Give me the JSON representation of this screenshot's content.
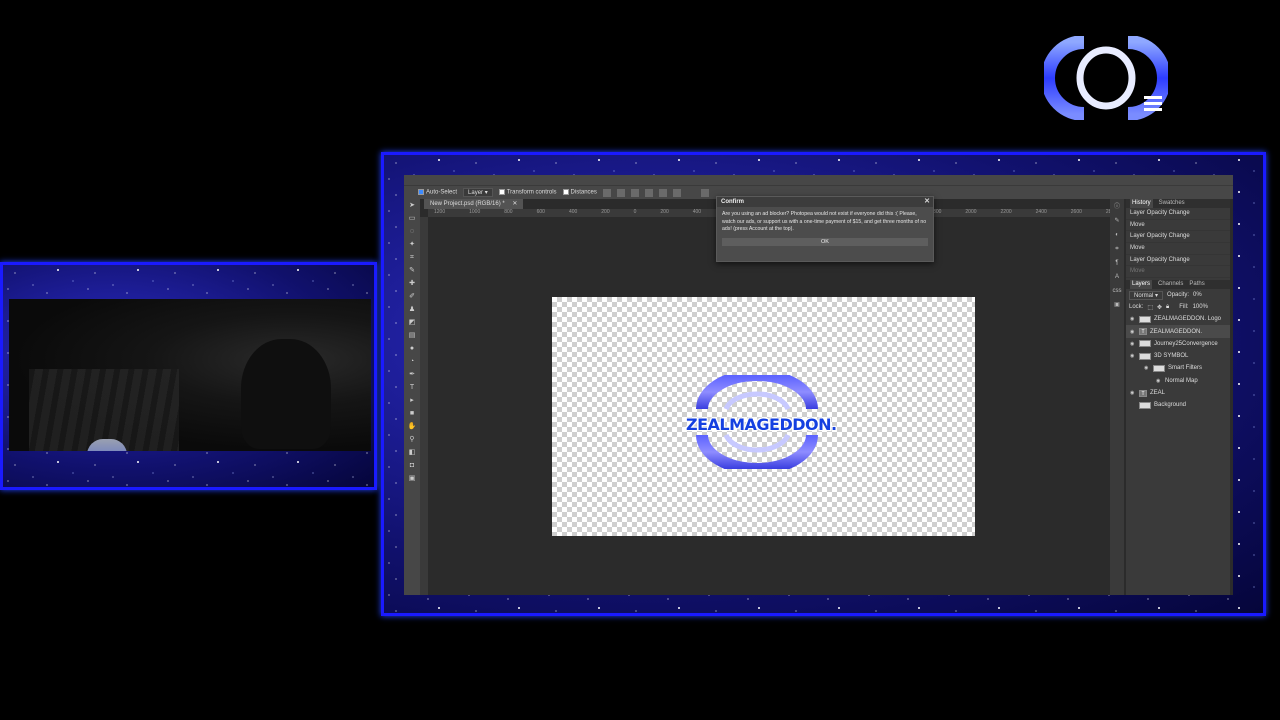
{
  "colors": {
    "frame_blue": "#1a1aff",
    "app_bg": "#2b2b2b",
    "panel_bg": "#3a3a3a",
    "logo_blue": "#1540e0"
  },
  "app": {
    "options_bar": {
      "auto_select": "Auto-Select",
      "layer_select": "Layer",
      "transform_controls": "Transform controls",
      "distances": "Distances"
    },
    "doc_tab": "New Project.psd (RGB/16) *",
    "ruler_ticks": [
      "1200",
      "1000",
      "800",
      "600",
      "400",
      "200",
      "0",
      "200",
      "400",
      "600",
      "800",
      "1000",
      "1200",
      "1400",
      "1600",
      "1800",
      "2000",
      "2200",
      "2400",
      "2600",
      "2800",
      "3000",
      "3200",
      "3400",
      "3600",
      "3800",
      "4000",
      "4200",
      "4400",
      "4600",
      "4800"
    ],
    "canvas_text": "ZEALMAGEDDON.",
    "dialog": {
      "title": "Confirm",
      "message": "Are you using an ad blocker? Photopea would not exist if everyone did this :( Please, watch our ads, or support us with a one-time payment of $15, and get three months of no ads! (press Account at the top).",
      "ok": "OK"
    },
    "history": {
      "tabs": [
        "History",
        "Swatches"
      ],
      "items": [
        "Layer Opacity Change",
        "Move",
        "Layer Opacity Change",
        "Move",
        "Layer Opacity Change",
        "Move"
      ]
    },
    "layers_panel": {
      "tabs": [
        "Layers",
        "Channels",
        "Paths"
      ],
      "blend_mode": "Normal",
      "opacity_label": "Opacity:",
      "opacity_value": "0%",
      "lock_label": "Lock:",
      "fill_label": "Fill:",
      "fill_value": "100%",
      "layers": [
        {
          "name": "ZEALMAGEDDON. Logo",
          "type": "image"
        },
        {
          "name": "ZEALMAGEDDON.",
          "type": "text"
        },
        {
          "name": "Journey25Convergence",
          "type": "image"
        },
        {
          "name": "3D SYMBOL",
          "type": "image"
        },
        {
          "name": "Smart Filters",
          "type": "filter"
        },
        {
          "name": "Normal Map",
          "type": "filter"
        },
        {
          "name": "ZEAL",
          "type": "text"
        },
        {
          "name": "Background",
          "type": "image"
        }
      ]
    }
  }
}
